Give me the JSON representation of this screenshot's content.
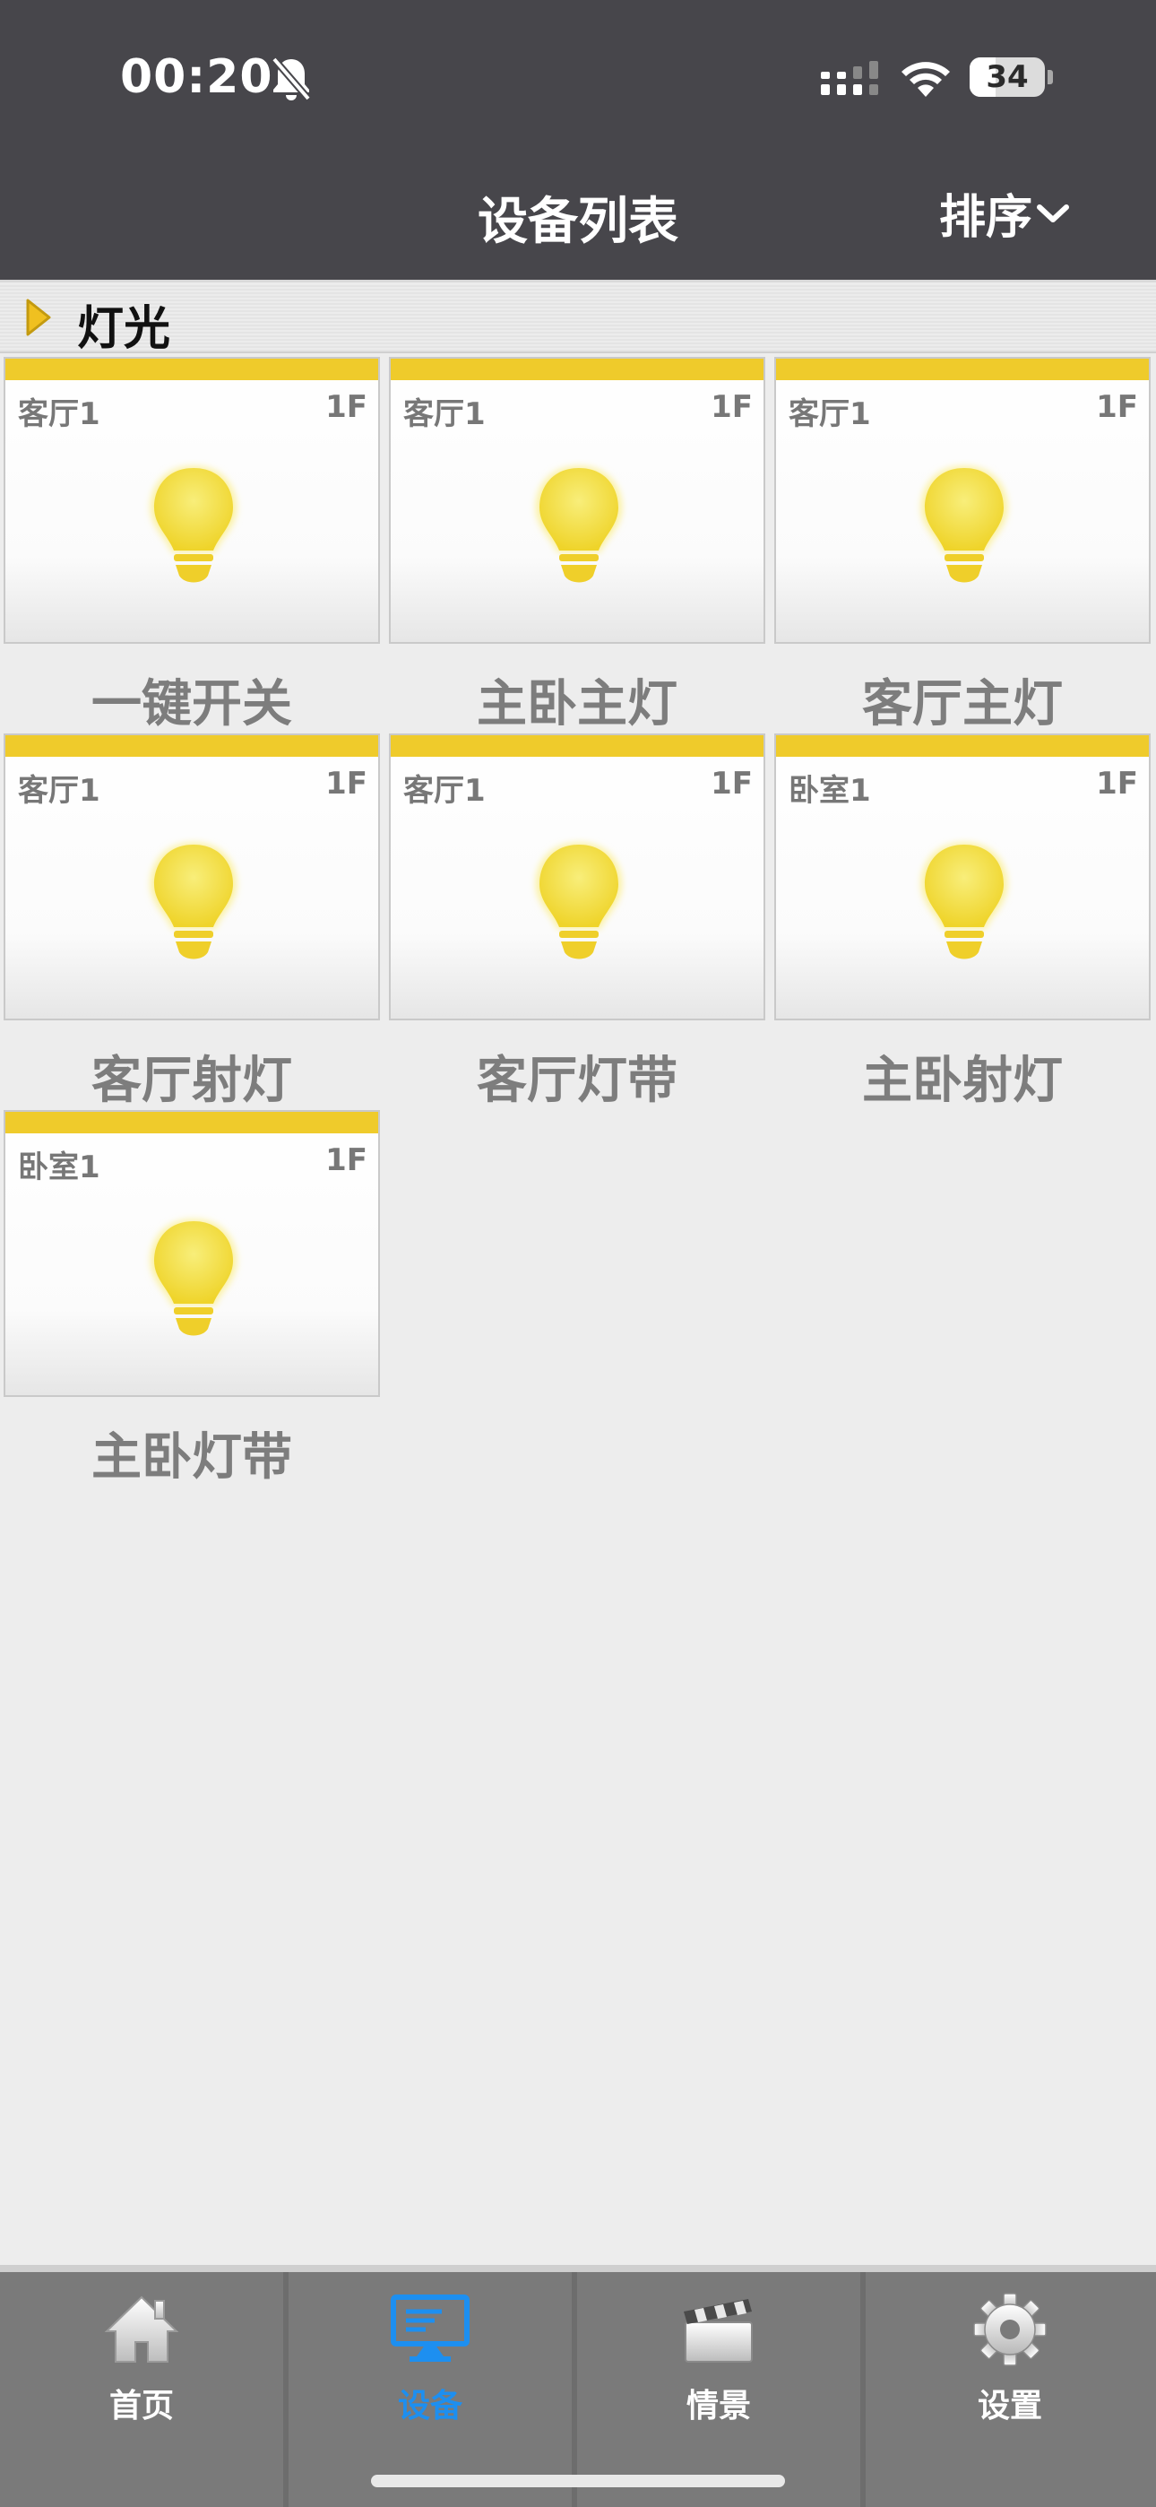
{
  "status_bar": {
    "time": "00:20",
    "battery": "34",
    "battery_level": 0.34
  },
  "header": {
    "title": "设备列表",
    "sort_label": "排序"
  },
  "section": {
    "title": "灯光"
  },
  "devices": [
    {
      "room": "客厅1",
      "floor": "1F",
      "name": "一键开关"
    },
    {
      "room": "客厅1",
      "floor": "1F",
      "name": "主卧主灯"
    },
    {
      "room": "客厅1",
      "floor": "1F",
      "name": "客厅主灯"
    },
    {
      "room": "客厅1",
      "floor": "1F",
      "name": "客厅射灯"
    },
    {
      "room": "客厅1",
      "floor": "1F",
      "name": "客厅灯带"
    },
    {
      "room": "卧室1",
      "floor": "1F",
      "name": "主卧射灯"
    },
    {
      "room": "卧室1",
      "floor": "1F",
      "name": "主卧灯带"
    }
  ],
  "tabs": [
    {
      "label": "首页",
      "icon": "home-icon",
      "active": false
    },
    {
      "label": "设备",
      "icon": "monitor-icon",
      "active": true
    },
    {
      "label": "情景",
      "icon": "clapperboard-icon",
      "active": false
    },
    {
      "label": "设置",
      "icon": "gear-icon",
      "active": false
    }
  ],
  "colors": {
    "header_bg": "#47464b",
    "tile_strip": "#efcb2b",
    "bulb": "#f2dc3a",
    "tab_bg": "#7a7a7a",
    "tab_active": "#1d8ff0"
  }
}
